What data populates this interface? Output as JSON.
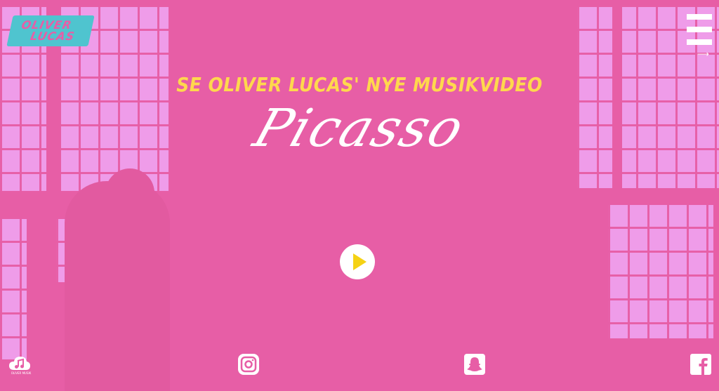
{
  "brand": {
    "logo_line1": "OLIVER",
    "logo_line2": "LUCAS"
  },
  "hero": {
    "headline": "SE OLIVER LUCAS' NYE MUSIKVIDEO",
    "video_title": "Picasso"
  },
  "icons": {
    "menu": "hamburger-menu-icon",
    "menu_arrow": "⟶",
    "play": "play-icon",
    "music_cloud": "music-cloud-icon",
    "instagram": "instagram-icon",
    "snapchat": "snapchat-icon",
    "facebook": "facebook-icon"
  },
  "footer": {
    "music_label": "OLIVER MUSIK"
  },
  "colors": {
    "background": "#e75ea6",
    "window_light": "#f0a2ef",
    "headline": "#ffd84d",
    "logo": "#4fc4cf",
    "play_triangle": "#f5d214"
  }
}
